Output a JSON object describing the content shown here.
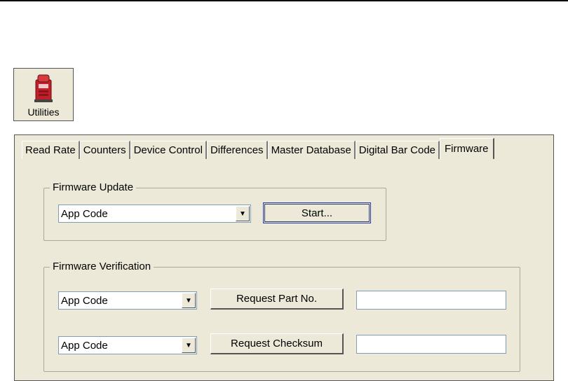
{
  "utilities_button": {
    "label": "Utilities",
    "icon": "utilities-icon"
  },
  "tabs": [
    {
      "label": "Read Rate"
    },
    {
      "label": "Counters"
    },
    {
      "label": "Device Control"
    },
    {
      "label": "Differences"
    },
    {
      "label": "Master Database"
    },
    {
      "label": "Digital Bar Code"
    },
    {
      "label": "Firmware",
      "active": true
    }
  ],
  "firmware_update": {
    "title": "Firmware Update",
    "combo_value": "App Code",
    "start_label": "Start..."
  },
  "firmware_verification": {
    "title": "Firmware Verification",
    "part_combo_value": "App Code",
    "part_button_label": "Request Part No.",
    "part_result": "",
    "checksum_combo_value": "App Code",
    "checksum_button_label": "Request Checksum",
    "checksum_result": ""
  },
  "colors": {
    "panel_bg": "#ece9d8",
    "field_border": "#7f9db9",
    "icon_red": "#c0202a"
  }
}
